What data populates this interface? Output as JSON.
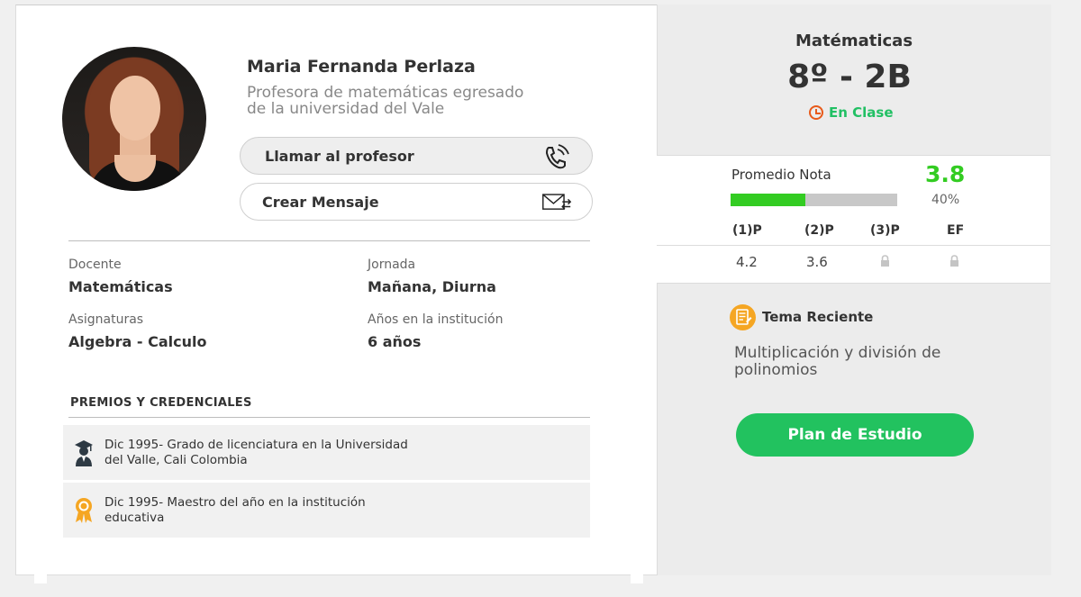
{
  "profile": {
    "name": "Maria Fernanda Perlaza",
    "bio": "Profesora de matemáticas egresado de la universidad del Vale",
    "call_label": "Llamar al profesor",
    "message_label": "Crear Mensaje"
  },
  "info": {
    "docente_label": "Docente",
    "docente_value": "Matemáticas",
    "jornada_label": "Jornada",
    "jornada_value": "Mañana, Diurna",
    "asignaturas_label": "Asignaturas",
    "asignaturas_value": "Algebra - Calculo",
    "anios_label": "Años en la institución",
    "anios_value": "6 años"
  },
  "awards": {
    "title": "PREMIOS Y CREDENCIALES",
    "items": [
      {
        "icon": "graduate-icon",
        "text": "Dic 1995- Grado de licenciatura en la Universidad del Valle, Cali Colombia"
      },
      {
        "icon": "award-ribbon-icon",
        "text": "Dic 1995- Maestro del año en la institución educativa"
      }
    ]
  },
  "class": {
    "subject": "Matématicas",
    "grade": "8º - 2B",
    "status": "En Clase",
    "status_color": "#22c064"
  },
  "grades": {
    "avg_label": "Promedio Nota",
    "avg_value": "3.8",
    "progress_pct": "40%",
    "progress_fraction": 0.45,
    "accent": "#33cc22",
    "columns": [
      {
        "head": "(1)P",
        "value": "4.2",
        "locked": false
      },
      {
        "head": "(2)P",
        "value": "3.6",
        "locked": false
      },
      {
        "head": "(3)P",
        "value": "",
        "locked": true
      },
      {
        "head": "EF",
        "value": "",
        "locked": true
      }
    ]
  },
  "topic": {
    "title": "Tema Reciente",
    "text": "Multiplicación y división de polinomios"
  },
  "plan_button": "Plan de Estudio"
}
